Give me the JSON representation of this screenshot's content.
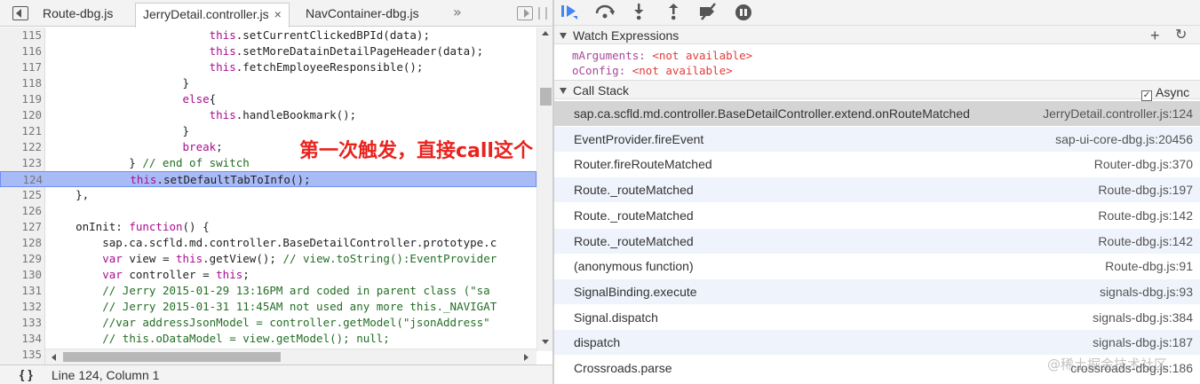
{
  "editor": {
    "tabs": [
      {
        "label": "Route-dbg.js",
        "active": false
      },
      {
        "label": "JerryDetail.controller.js",
        "active": true,
        "close": "×"
      },
      {
        "label": "NavContainer-dbg.js",
        "active": false
      }
    ],
    "more_tabs": "»",
    "highlight_line": 124,
    "lines": [
      {
        "n": "115",
        "t": "                        this.setCurrentClickedBPId(data);"
      },
      {
        "n": "116",
        "t": "                        this.setMoreDatainDetailPageHeader(data);"
      },
      {
        "n": "117",
        "t": "                        this.fetchEmployeeResponsible();"
      },
      {
        "n": "118",
        "t": "                    }"
      },
      {
        "n": "119",
        "t": "                    else{"
      },
      {
        "n": "120",
        "t": "                        this.handleBookmark();"
      },
      {
        "n": "121",
        "t": "                    }"
      },
      {
        "n": "122",
        "t": "                    break;"
      },
      {
        "n": "123",
        "t": "            } // end of switch"
      },
      {
        "n": "124",
        "t": "            this.setDefaultTabToInfo();"
      },
      {
        "n": "125",
        "t": "    },"
      },
      {
        "n": "126",
        "t": ""
      },
      {
        "n": "127",
        "t": "    onInit: function() {"
      },
      {
        "n": "128",
        "t": "        sap.ca.scfld.md.controller.BaseDetailController.prototype.c"
      },
      {
        "n": "129",
        "t": "        var view = this.getView(); // view.toString():EventProvider"
      },
      {
        "n": "130",
        "t": "        var controller = this;"
      },
      {
        "n": "131",
        "t": "        // Jerry 2015-01-29 13:16PM ard coded in parent class (\"sa"
      },
      {
        "n": "132",
        "t": "        // Jerry 2015-01-31 11:45AM not used any more this._NAVIGAT"
      },
      {
        "n": "133",
        "t": "        //var addressJsonModel = controller.getModel(\"jsonAddress\""
      },
      {
        "n": "134",
        "t": "        // this.oDataModel = view.getModel(); null;"
      },
      {
        "n": "135",
        "t": ""
      }
    ],
    "status": {
      "braces": "{ }",
      "cursor": "Line 124, Column 1"
    }
  },
  "annotation": "第一次触发，直接call这个",
  "debugger": {
    "toolbar_icons": [
      "resume-icon",
      "step-over-icon",
      "step-into-icon",
      "step-out-icon",
      "deactivate-breakpoints-icon",
      "pause-on-exceptions-icon"
    ],
    "watch": {
      "title": "Watch Expressions",
      "add": "+",
      "refresh": "↻",
      "items": [
        {
          "name": "mArguments",
          "value": "<not available>"
        },
        {
          "name": "oConfig",
          "value": "<not available>"
        }
      ]
    },
    "callstack": {
      "title": "Call Stack",
      "async_label": "Async",
      "async_checked": true,
      "frames": [
        {
          "name": "sap.ca.scfld.md.controller.BaseDetailController.extend.onRouteMatched",
          "loc": "JerryDetail.controller.js:124"
        },
        {
          "name": "EventProvider.fireEvent",
          "loc": "sap-ui-core-dbg.js:20456"
        },
        {
          "name": "Router.fireRouteMatched",
          "loc": "Router-dbg.js:370"
        },
        {
          "name": "Route._routeMatched",
          "loc": "Route-dbg.js:197"
        },
        {
          "name": "Route._routeMatched",
          "loc": "Route-dbg.js:142"
        },
        {
          "name": "Route._routeMatched",
          "loc": "Route-dbg.js:142"
        },
        {
          "name": "(anonymous function)",
          "loc": "Route-dbg.js:91"
        },
        {
          "name": "SignalBinding.execute",
          "loc": "signals-dbg.js:93"
        },
        {
          "name": "Signal.dispatch",
          "loc": "signals-dbg.js:384"
        },
        {
          "name": "dispatch",
          "loc": "signals-dbg.js:187"
        },
        {
          "name": "Crossroads.parse",
          "loc": "crossroads-dbg.js:186"
        }
      ]
    }
  },
  "watermark": "@稀土掘金技术社区"
}
